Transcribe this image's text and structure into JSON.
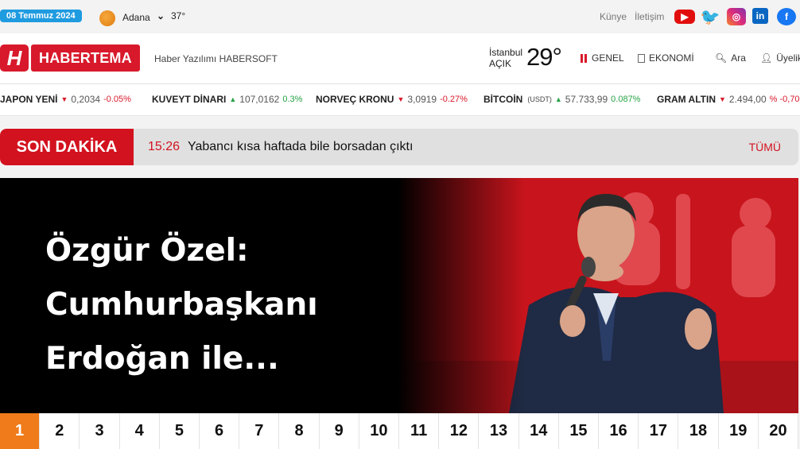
{
  "topbar": {
    "date": "08 Temmuz 2024",
    "city": "Adana",
    "temp": "37°",
    "links": [
      "Künye",
      "İletişim"
    ],
    "social": [
      "youtube-icon",
      "twitter-icon",
      "instagram-icon",
      "linkedin-icon",
      "facebook-icon"
    ]
  },
  "header": {
    "logo_mark": "H",
    "logo_text": "HABERTEMA",
    "tagline": "Haber Yazılımı HABERSOFT",
    "weather_city": "İstanbul",
    "weather_state": "AÇIK",
    "weather_temp": "29°",
    "nav": {
      "general": "GENEL",
      "economy": "EKONOMİ",
      "search": "Ara",
      "user": "Üyelik"
    }
  },
  "ticker": [
    {
      "name": "JAPON YENİ",
      "unit": "",
      "value": "0,2034",
      "change": "-0.05%",
      "dir": "down"
    },
    {
      "name": "KUVEYT DİNARI",
      "unit": "",
      "value": "107,0162",
      "change": "0.3%",
      "dir": "up"
    },
    {
      "name": "NORVEÇ KRONU",
      "unit": "",
      "value": "3,0919",
      "change": "-0.27%",
      "dir": "down"
    },
    {
      "name": "BİTCOİN",
      "unit": "(USDT)",
      "value": "57.733,99",
      "change": "0.087%",
      "dir": "up"
    },
    {
      "name": "GRAM ALTIN",
      "unit": "",
      "value": "2.494,00",
      "change": "% -0,70",
      "dir": "down"
    }
  ],
  "breaking": {
    "label": "SON DAKİKA",
    "time": "15:26",
    "text": "Yabancı kısa haftada bile borsadan çıktı",
    "all": "TÜMÜ"
  },
  "hero": {
    "title": "Özgür Özel: Cumhurbaşkanı Erdoğan ile..."
  },
  "pager": [
    "1",
    "2",
    "3",
    "4",
    "5",
    "6",
    "7",
    "8",
    "9",
    "10",
    "11",
    "12",
    "13",
    "14",
    "15",
    "16",
    "17",
    "18",
    "19",
    "20"
  ],
  "colors": {
    "brand_red": "#d8192b",
    "pager_active": "#ef7b1a",
    "date_blue": "#1f9be0"
  }
}
